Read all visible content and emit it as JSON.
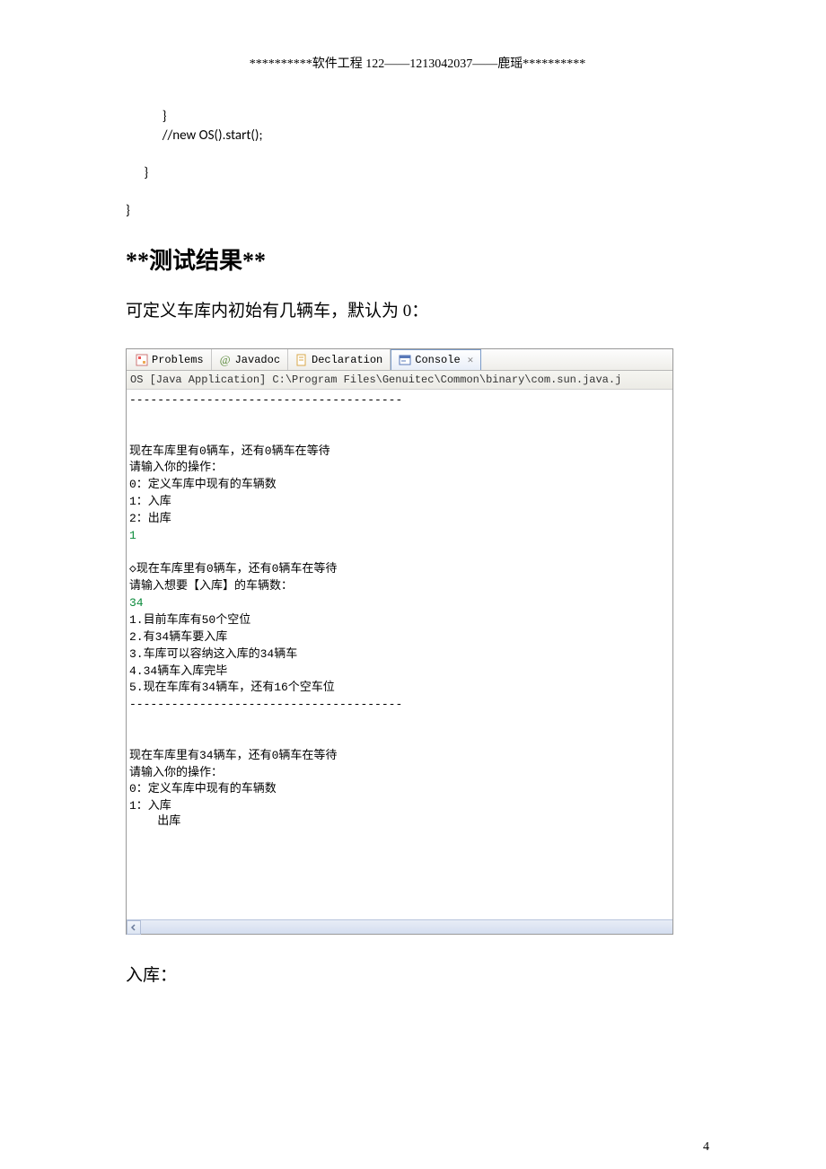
{
  "header": "**********软件工程 122——1213042037——鹿瑶**********",
  "code": {
    "line1": "            }",
    "line2": "            //new OS().start();",
    "line3": "      }",
    "line4": "}"
  },
  "section_title": "**测试结果**",
  "intro_text": "可定义车库内初始有几辆车，默认为 0：",
  "tabs": {
    "problems": "Problems",
    "javadoc": "Javadoc",
    "declaration": "Declaration",
    "console": "Console"
  },
  "path_line": "OS [Java Application] C:\\Program Files\\Genuitec\\Common\\binary\\com.sun.java.j",
  "console": {
    "dash": "---------------------------------------",
    "block1_l1": "现在车库里有0辆车，还有0辆车在等待",
    "block1_l2": "请输入你的操作：",
    "block1_l3": "0：定义车库中现有的车辆数",
    "block1_l4": "1：入库",
    "block1_l5": "2：出库",
    "input1": "1",
    "block2_l1": "◇现在车库里有0辆车，还有0辆车在等待",
    "block2_l2": "请输入想要【入库】的车辆数：",
    "input2": "34",
    "block3_l1": "1.目前车库有50个空位",
    "block3_l2": "2.有34辆车要入库",
    "block3_l3": "3.车库可以容纳这入库的34辆车",
    "block3_l4": "4.34辆车入库完毕",
    "block3_l5": "5.现在车库有34辆车，还有16个空车位",
    "block4_l1": "现在车库里有34辆车，还有0辆车在等待",
    "block4_l2": "请输入你的操作：",
    "block4_l3": "0：定义车库中现有的车辆数",
    "block4_l4": "1：入库",
    "block4_l5": "    出库"
  },
  "footer_text": "入库：",
  "page_num": "4"
}
